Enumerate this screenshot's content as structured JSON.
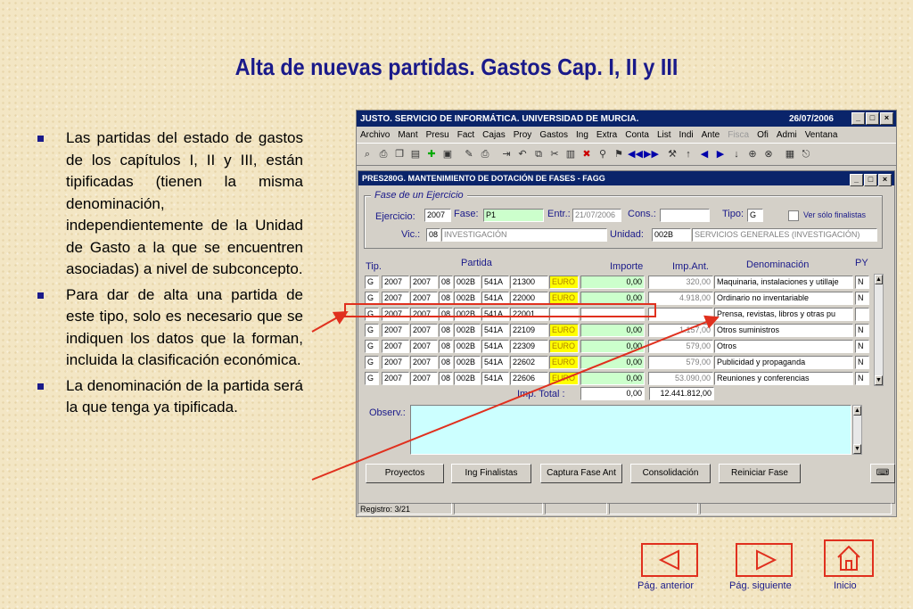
{
  "slide": {
    "title": "Alta de nuevas partidas. Gastos Cap. I, II y III",
    "bullets": [
      "Las partidas del estado de gastos de los capítulos I, II y III, están tipificadas (tienen la misma denominación, independientemente de la Unidad de Gasto a la que se encuentren asociadas) a nivel de subconcepto.",
      "Para dar de alta una partida de este tipo, solo es necesario que se indiquen los datos que la forman, incluida la clasificación económica.",
      "La denominación de la partida será la que tenga ya tipificada."
    ]
  },
  "window": {
    "title": "JUSTO. SERVICIO DE INFORMÁTICA. UNIVERSIDAD DE MURCIA.",
    "date": "26/07/2006",
    "menu": [
      "Archivo",
      "Mant",
      "Presu",
      "Fact",
      "Cajas",
      "Proy",
      "Gastos",
      "Ing",
      "Extra",
      "Conta",
      "List",
      "Indi",
      "Ante",
      "Fisca",
      "Ofi",
      "Admi",
      "Ventana"
    ],
    "menu_disabled": "Fisca"
  },
  "form": {
    "title": "PRES280G. MANTENIMIENTO DE DOTACIÓN DE FASES - FAGG",
    "group_label": "Fase de un Ejercicio",
    "ejercicio_label": "Ejercicio:",
    "ejercicio": "2007",
    "fase_label": "Fase:",
    "fase": "P1",
    "entr_label": "Entr.:",
    "entr": "21/07/2006",
    "cons_label": "Cons.:",
    "cons": "",
    "tipo_label": "Tipo:",
    "tipo": "G",
    "finalistas_label": "Ver sólo finalistas",
    "vic_label": "Vic.:",
    "vic_code": "08",
    "vic_name": "INVESTIGACIÓN",
    "unidad_label": "Unidad:",
    "unidad_code": "002B",
    "unidad_name": "SERVICIOS GENERALES (INVESTIGACIÓN)"
  },
  "grid": {
    "headers": {
      "tip": "Tip.",
      "partida": "Partida",
      "importe": "Importe",
      "imp_ant": "Imp.Ant.",
      "denominacion": "Denominación",
      "py": "PY"
    },
    "rows": [
      {
        "tip": "G",
        "c1": "2007",
        "c2": "2007",
        "c3": "08",
        "c4": "002B",
        "c5": "541A",
        "c6": "21300",
        "mon": "EURO",
        "importe": "0,00",
        "imp_ant": "320,00",
        "den": "Maquinaria, instalaciones y utillaje",
        "py": "N"
      },
      {
        "tip": "G",
        "c1": "2007",
        "c2": "2007",
        "c3": "08",
        "c4": "002B",
        "c5": "541A",
        "c6": "22000",
        "mon": "EURO",
        "importe": "0,00",
        "imp_ant": "4.918,00",
        "den": "Ordinario no inventariable",
        "py": "N"
      },
      {
        "tip": "G",
        "c1": "2007",
        "c2": "2007",
        "c3": "08",
        "c4": "002B",
        "c5": "541A",
        "c6": "22001",
        "mon": "",
        "importe": "",
        "imp_ant": "",
        "den": "Prensa, revistas, libros y otras pu",
        "py": ""
      },
      {
        "tip": "G",
        "c1": "2007",
        "c2": "2007",
        "c3": "08",
        "c4": "002B",
        "c5": "541A",
        "c6": "22109",
        "mon": "EURO",
        "importe": "0,00",
        "imp_ant": "1.157,00",
        "den": "Otros suministros",
        "py": "N"
      },
      {
        "tip": "G",
        "c1": "2007",
        "c2": "2007",
        "c3": "08",
        "c4": "002B",
        "c5": "541A",
        "c6": "22309",
        "mon": "EURO",
        "importe": "0,00",
        "imp_ant": "579,00",
        "den": "Otros",
        "py": "N"
      },
      {
        "tip": "G",
        "c1": "2007",
        "c2": "2007",
        "c3": "08",
        "c4": "002B",
        "c5": "541A",
        "c6": "22602",
        "mon": "EURO",
        "importe": "0,00",
        "imp_ant": "579,00",
        "den": "Publicidad y propaganda",
        "py": "N"
      },
      {
        "tip": "G",
        "c1": "2007",
        "c2": "2007",
        "c3": "08",
        "c4": "002B",
        "c5": "541A",
        "c6": "22606",
        "mon": "EURO",
        "importe": "0,00",
        "imp_ant": "53.090,00",
        "den": "Reuniones y conferencias",
        "py": "N"
      }
    ],
    "total_label": "Imp. Total :",
    "total_importe": "0,00",
    "total_ant": "12.441.812,00",
    "observ_label": "Observ.:"
  },
  "buttons": [
    "Proyectos",
    "Ing Finalistas",
    "Captura Fase Ant",
    "Consolidación",
    "Reiniciar Fase"
  ],
  "status": {
    "registro": "Registro: 3/21"
  },
  "nav": {
    "prev": "Pág. anterior",
    "next": "Pág. siguiente",
    "home": "Inicio"
  },
  "colors": {
    "title": "#1a1a8a",
    "accent_red": "#e0301e",
    "titlebar": "#0a246a",
    "background": "#f3e6c4"
  }
}
